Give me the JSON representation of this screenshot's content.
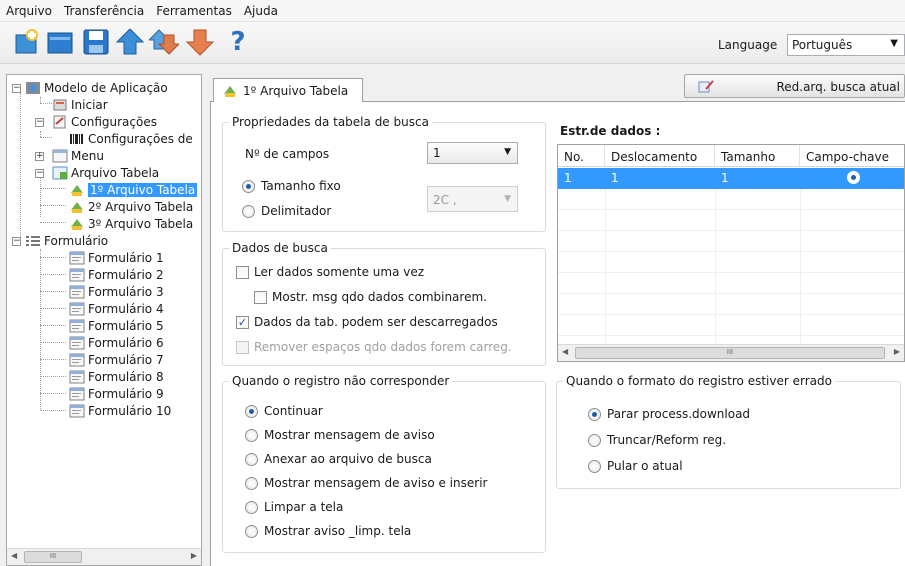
{
  "menu": [
    "Arquivo",
    "Transferência",
    "Ferramentas",
    "Ajuda"
  ],
  "toolbar": {
    "icons": [
      "new-icon",
      "open-icon",
      "save-icon",
      "upload-icon",
      "transfer-icon",
      "download-icon",
      "help-icon"
    ],
    "help_glyph": "?",
    "language_label": "Language",
    "language_value": "Português"
  },
  "tree": {
    "root": "Modelo de Aplicação",
    "iniciar": "Iniciar",
    "configuracoes": "Configurações",
    "configuracoes_child": "Configurações de",
    "menu": "Menu",
    "arquivo_tabela": "Arquivo Tabela",
    "tabelas": [
      "1º Arquivo Tabela",
      "2º Arquivo Tabela",
      "3º Arquivo Tabela"
    ],
    "selected": "1º Arquivo Tabela",
    "formulario": "Formulário",
    "formularios": [
      "Formulário 1",
      "Formulário 2",
      "Formulário 3",
      "Formulário 4",
      "Formulário 5",
      "Formulário 6",
      "Formulário 7",
      "Formulário 8",
      "Formulário 9",
      "Formulário 10"
    ]
  },
  "tab": {
    "label": "1º Arquivo Tabela"
  },
  "red_button": {
    "label": "Red.arq. busca atual"
  },
  "propriedades": {
    "title": "Propriedades da tabela de busca",
    "n_campos_label": "Nº de campos",
    "n_campos_value": "1",
    "tamanho_fixo": "Tamanho fixo",
    "delimitador": "Delimitador",
    "delimitador_value": "2C ,",
    "mode": "tamanho_fixo"
  },
  "dados_busca": {
    "title": "Dados de busca",
    "ler_uma_vez": "Ler dados somente uma vez",
    "mostr_msg": "Mostr. msg qdo dados combinarem.",
    "descarregados": "Dados da tab. podem ser descarregados",
    "remover": "Remover espaços qdo dados forem carreg.",
    "ler_uma_vez_checked": false,
    "mostr_msg_checked": false,
    "descarregados_checked": true,
    "remover_checked": false
  },
  "estr": {
    "label": "Estr.de dados :",
    "columns": [
      "No.",
      "Deslocamento",
      "Tamanho",
      "Campo-chave"
    ],
    "rows": [
      [
        "1",
        "1",
        "1",
        "selected"
      ]
    ]
  },
  "nao_corresponder": {
    "title": "Quando o registro não corresponder",
    "options": [
      "Continuar",
      "Mostrar mensagem de aviso",
      "Anexar ao arquivo de busca",
      "Mostrar mensagem de aviso e inserir",
      "Limpar a tela",
      "Mostrar aviso _limp. tela"
    ],
    "selected_index": 0
  },
  "formato_errado": {
    "title": "Quando o formato do registro estiver errado",
    "options": [
      "Parar process.download",
      "Truncar/Reform reg.",
      "Pular o atual"
    ],
    "selected_index": 0
  },
  "scrollbar_glyph": "III"
}
